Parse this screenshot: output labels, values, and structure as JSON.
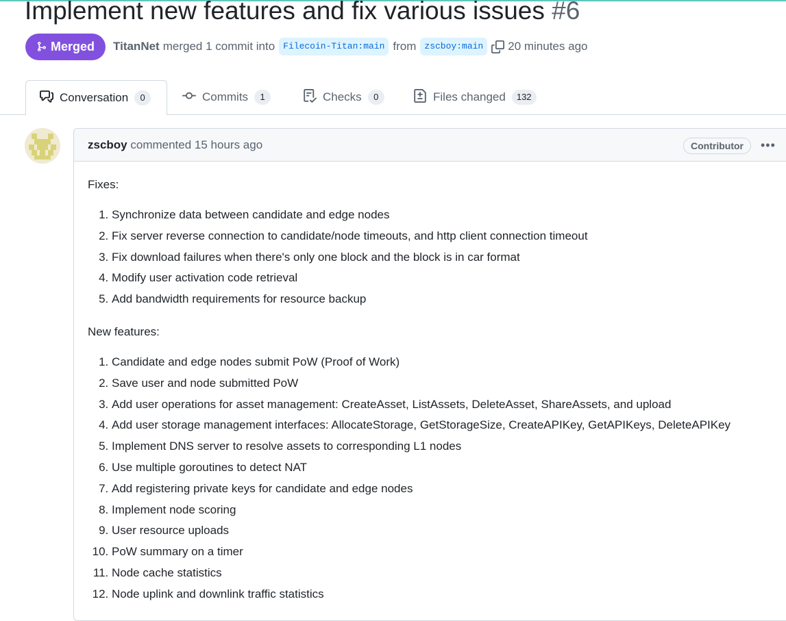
{
  "pr": {
    "title": "Implement new features and fix various issues",
    "number": "#6",
    "status": "Merged",
    "author": "TitanNet",
    "merge_text": "merged 1 commit into",
    "base_branch": "Filecoin-Titan:main",
    "from_text": "from",
    "head_branch": "zscboy:main",
    "time": "20 minutes ago"
  },
  "tabs": [
    {
      "label": "Conversation",
      "count": "0",
      "icon": "comment-discussion-icon"
    },
    {
      "label": "Commits",
      "count": "1",
      "icon": "git-commit-icon"
    },
    {
      "label": "Checks",
      "count": "0",
      "icon": "checklist-icon"
    },
    {
      "label": "Files changed",
      "count": "132",
      "icon": "file-diff-icon"
    }
  ],
  "comment": {
    "author": "zscboy",
    "action": "commented 15 hours ago",
    "role": "Contributor",
    "fixes_label": "Fixes:",
    "fixes": [
      "Synchronize data between candidate and edge nodes",
      "Fix server reverse connection to candidate/node timeouts, and http client connection timeout",
      "Fix download failures when there's only one block and the block is in car format",
      "Modify user activation code retrieval",
      "Add bandwidth requirements for resource backup"
    ],
    "features_label": "New features:",
    "features": [
      "Candidate and edge nodes submit PoW (Proof of Work)",
      "Save user and node submitted PoW",
      "Add user operations for asset management: CreateAsset, ListAssets, DeleteAsset, ShareAssets, and upload",
      "Add user storage management interfaces: AllocateStorage, GetStorageSize, CreateAPIKey, GetAPIKeys, DeleteAPIKey",
      "Implement DNS server to resolve assets to corresponding L1 nodes",
      "Use multiple goroutines to detect NAT",
      "Add registering private keys for candidate and edge nodes",
      "Implement node scoring",
      "User resource uploads",
      "PoW summary on a timer",
      "Node cache statistics",
      "Node uplink and downlink traffic statistics"
    ]
  },
  "colors": {
    "merged": "#8250df",
    "branch_bg": "#ddf4ff",
    "branch_fg": "#0969da",
    "muted": "#59636e"
  }
}
